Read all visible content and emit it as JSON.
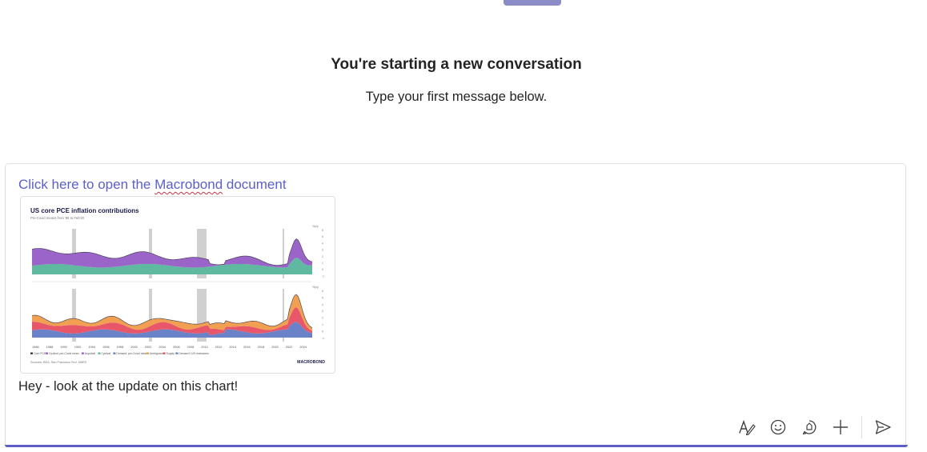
{
  "empty_state": {
    "title": "You're starting a new conversation",
    "subtitle": "Type your first message below."
  },
  "message": {
    "link_text_before": "Click here to open the ",
    "link_text_misspelled": "Macrobond",
    "link_text_after": " document",
    "text": "Hey - look at the update on this chart!"
  },
  "chart_card": {
    "title": "US core PCE inflation contributions",
    "subtitle": "Pre-Covid means from '85 to Feb'20",
    "unit_label": "%y/y",
    "brand": "MACROBOND",
    "sources": "Sources: BEA, San Francisco Fed, NBER",
    "legend": [
      "Core PCE",
      "Cyclical, pre-Covid mean",
      "Acyclical",
      "Cyclical",
      "Demand, pre-Covid mean",
      "Ambiguous",
      "Supply",
      "Demand",
      "US recessions"
    ],
    "x_ticks": [
      "1986",
      "1988",
      "1990",
      "1992",
      "1994",
      "1996",
      "1998",
      "2000",
      "2002",
      "2004",
      "2006",
      "2008",
      "2010",
      "2012",
      "2014",
      "2016",
      "2018",
      "2020",
      "2022",
      "2024"
    ],
    "y_ticks_top": [
      "6",
      "5",
      "4",
      "3",
      "2",
      "1",
      "0",
      "-1"
    ],
    "y_ticks_bottom": [
      "6",
      "5",
      "4",
      "3",
      "2",
      "1",
      "0",
      "-1"
    ],
    "colors": {
      "acyclical": "#5fb8a0",
      "cyclical": "#9b64c8",
      "ambiguous": "#f0a050",
      "supply": "#e8566a",
      "demand": "#6a82c8",
      "recession": "#d0d0d0",
      "core": "#3a3a4a"
    }
  },
  "toolbar": {
    "icons": [
      "format-icon",
      "emoji-icon",
      "loop-icon",
      "attach-icon",
      "send-icon"
    ]
  }
}
